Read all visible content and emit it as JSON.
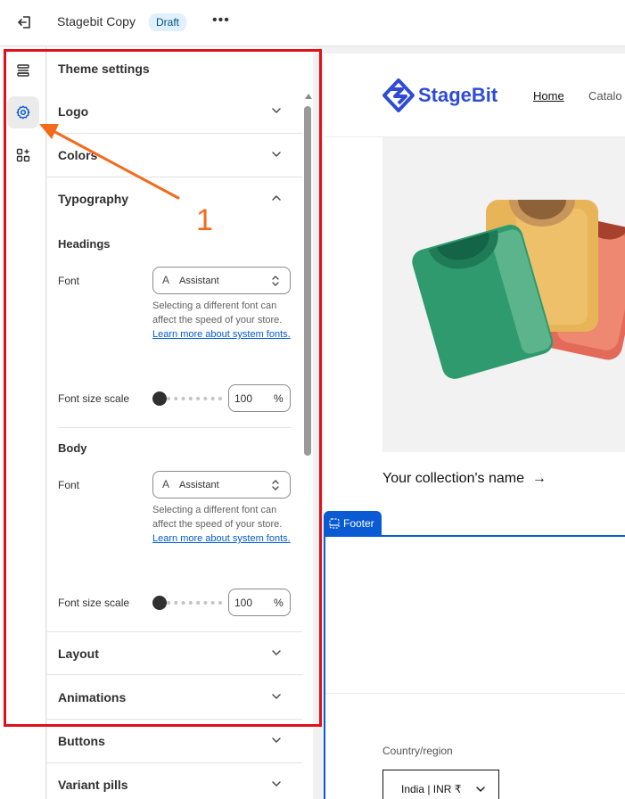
{
  "topbar": {
    "store_name": "Stagebit Copy",
    "status_badge": "Draft",
    "more_label": "•••"
  },
  "panel": {
    "title": "Theme settings",
    "sections": {
      "logo": "Logo",
      "colors": "Colors",
      "typography": "Typography",
      "layout": "Layout",
      "animations": "Animations",
      "buttons": "Buttons",
      "variant_pills": "Variant pills"
    },
    "headings": {
      "title": "Headings",
      "font_label": "Font",
      "font_value": "Assistant",
      "help_text": "Selecting a different font can affect the speed of your store.",
      "help_link": "Learn more about system fonts.",
      "size_label": "Font size scale",
      "size_value": "100",
      "size_unit": "%",
      "size_level": 0
    },
    "body": {
      "title": "Body",
      "font_label": "Font",
      "font_value": "Assistant",
      "help_text": "Selecting a different font can affect the speed of your store.",
      "help_link": "Learn more about system fonts.",
      "size_label": "Font size scale",
      "size_value": "100",
      "size_unit": "%",
      "size_level": 0
    }
  },
  "preview": {
    "logo_text": "StageBit",
    "nav": {
      "home": "Home",
      "catalog": "Catalo"
    },
    "collection_name": "Your collection's name",
    "collection_arrow": "→",
    "footer_tab": "Footer",
    "country_label": "Country/region",
    "country_value": "India | INR ₹"
  },
  "annotation": {
    "number": "1"
  },
  "colors": {
    "accent_blue": "#0a5bd3",
    "highlight_red": "#e0101a",
    "arrow_orange": "#f36a1c",
    "logo_blue": "#2f4bd6"
  }
}
